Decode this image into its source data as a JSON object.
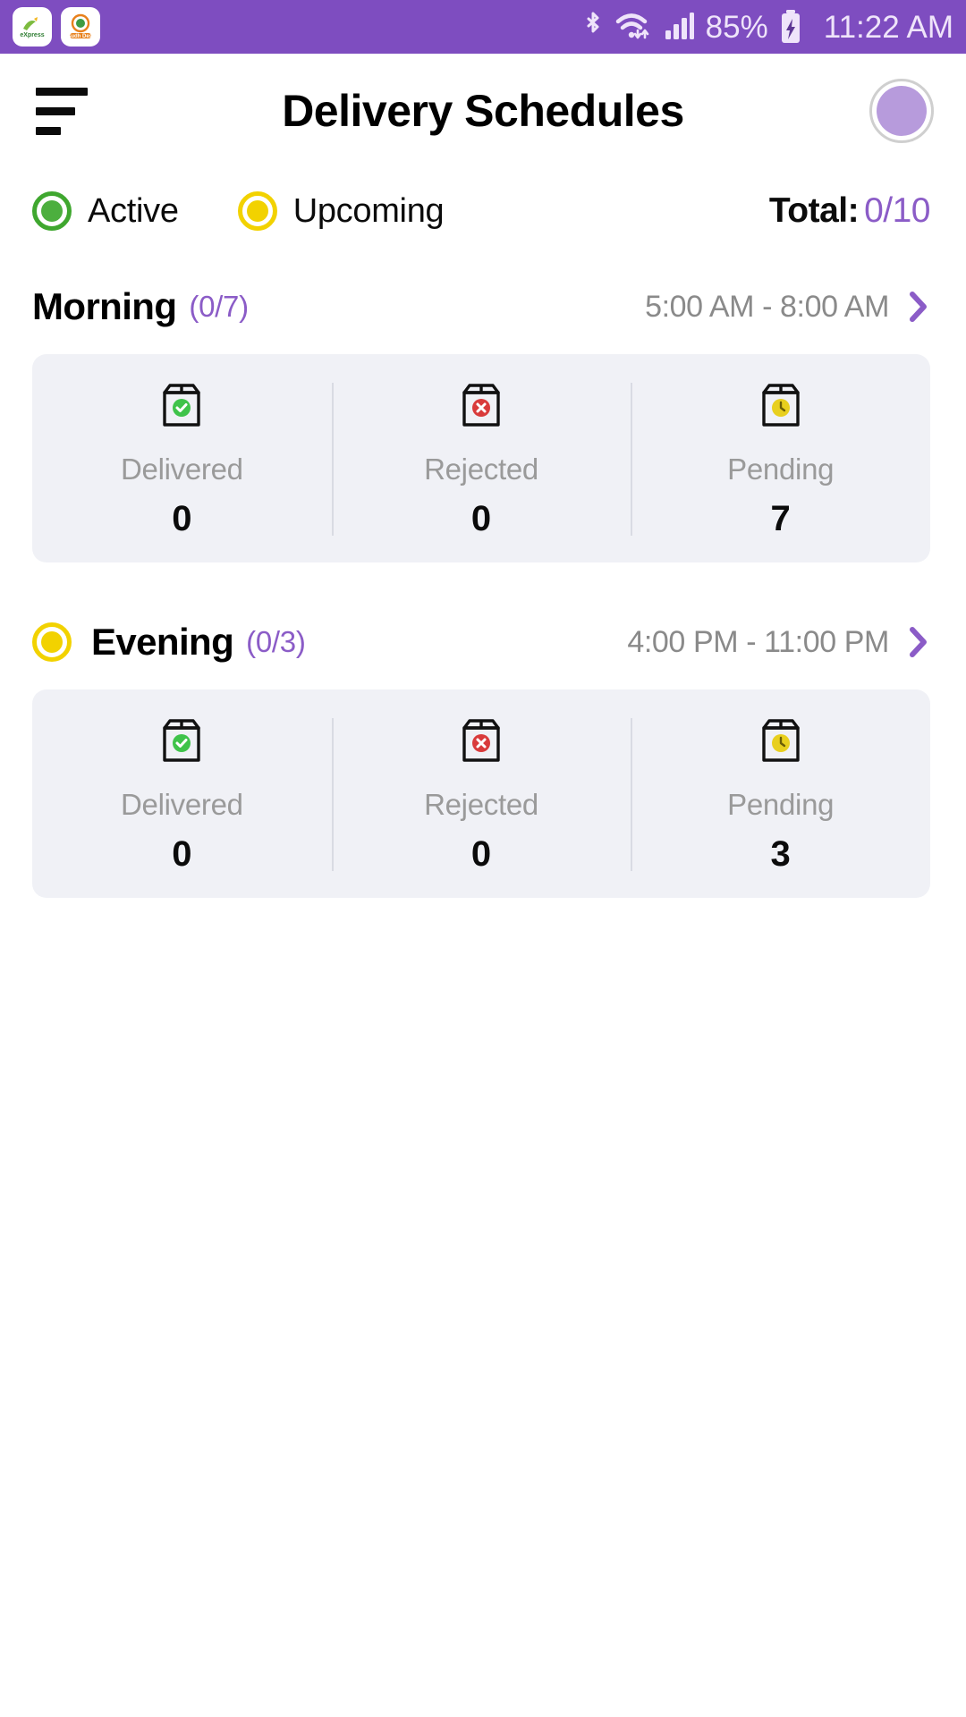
{
  "statusbar": {
    "notification_apps": [
      "kisan-express-app-icon",
      "sudh-desi-app-icon"
    ],
    "bluetooth_icon": "bluetooth-icon",
    "wifi_icon": "wifi-icon",
    "signal_icon": "cellular-signal-icon",
    "battery_percent": "85%",
    "battery_icon": "battery-charging-icon",
    "time": "11:22 AM",
    "background_color": "#7E4DC0"
  },
  "header": {
    "menu_icon": "hamburger-menu-icon",
    "title": "Delivery Schedules",
    "avatar_icon": "user-avatar",
    "avatar_color": "#B79BDC"
  },
  "legend": {
    "items": [
      {
        "label": "Active",
        "color": "#4CAF3E",
        "status": "active"
      },
      {
        "label": "Upcoming",
        "color": "#F2D200",
        "status": "upcoming"
      }
    ],
    "total_label": "Total:",
    "total_value": "0/10",
    "total_color": "#8B5CC7"
  },
  "schedules": [
    {
      "name": "Morning",
      "count": "(0/7)",
      "time_range": "5:00 AM - 8:00 AM",
      "status_dot": null,
      "chevron_icon": "chevron-right-icon",
      "stats": [
        {
          "label": "Delivered",
          "value": "0",
          "icon": "package-delivered-icon",
          "badge_color": "#3FC34A"
        },
        {
          "label": "Rejected",
          "value": "0",
          "icon": "package-rejected-icon",
          "badge_color": "#D93B3B"
        },
        {
          "label": "Pending",
          "value": "7",
          "icon": "package-pending-icon",
          "badge_color": "#E8CF1E"
        }
      ]
    },
    {
      "name": "Evening",
      "count": "(0/3)",
      "time_range": "4:00 PM - 11:00 PM",
      "status_dot": "upcoming",
      "chevron_icon": "chevron-right-icon",
      "stats": [
        {
          "label": "Delivered",
          "value": "0",
          "icon": "package-delivered-icon",
          "badge_color": "#3FC34A"
        },
        {
          "label": "Rejected",
          "value": "0",
          "icon": "package-rejected-icon",
          "badge_color": "#D93B3B"
        },
        {
          "label": "Pending",
          "value": "3",
          "icon": "package-pending-icon",
          "badge_color": "#E8CF1E"
        }
      ]
    }
  ]
}
